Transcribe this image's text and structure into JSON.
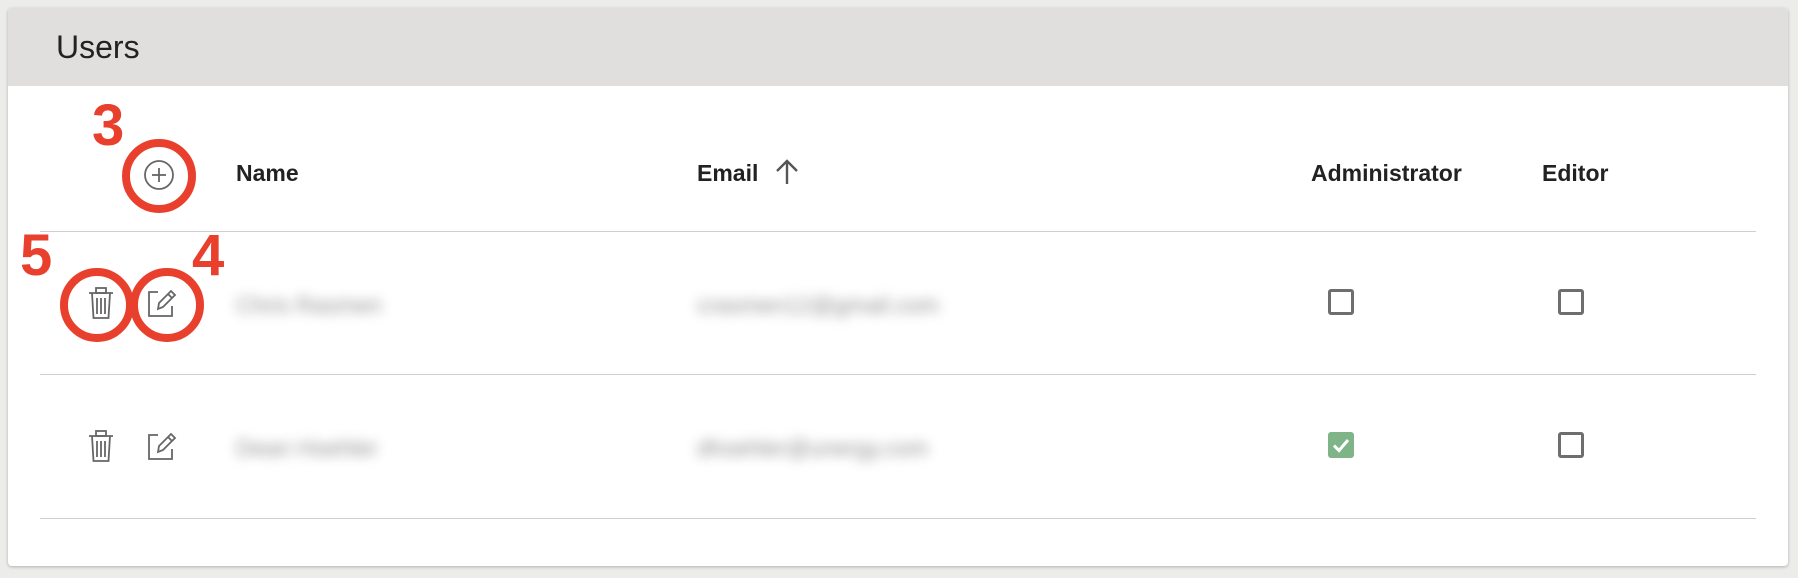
{
  "panel": {
    "title": "Users"
  },
  "table": {
    "columns": {
      "name": "Name",
      "email": "Email",
      "administrator": "Administrator",
      "editor": "Editor"
    },
    "sort": {
      "column": "email",
      "direction": "ascending",
      "icon": "arrow-up-icon"
    },
    "rows": [
      {
        "name": "Chris Rasmen",
        "email": "crasmen12@gmail.com",
        "administrator": false,
        "editor": false
      },
      {
        "name": "Dean Hoehler",
        "email": "dhoehler@unergy.com",
        "administrator": true,
        "editor": false
      }
    ],
    "row_actions": [
      "trash-icon",
      "edit-icon"
    ],
    "header_action": "add-circle-icon"
  },
  "annotations": [
    {
      "number": "3",
      "target": "add-user-button"
    },
    {
      "number": "4",
      "target": "edit-button"
    },
    {
      "number": "5",
      "target": "delete-button"
    }
  ],
  "colors": {
    "header_bg": "#e0dfdd",
    "annotation": "#e8402d",
    "checked": "#7fb489"
  }
}
